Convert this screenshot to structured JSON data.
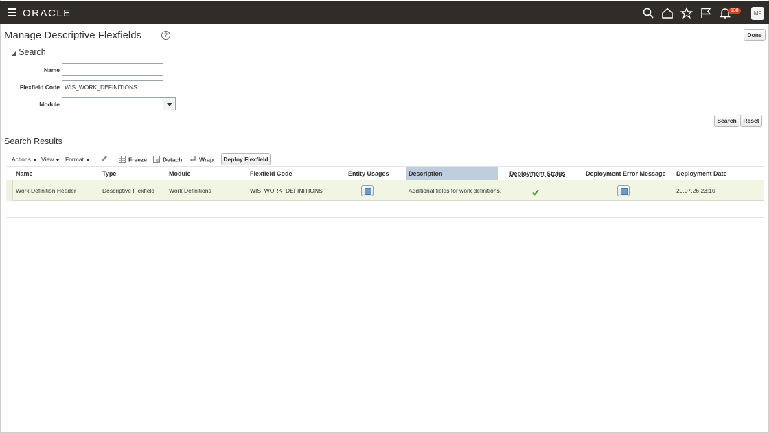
{
  "header": {
    "logo": "ORACLE",
    "notifications_count": "138",
    "user_initials": "MF"
  },
  "page": {
    "title": "Manage Descriptive Flexfields",
    "help": "?",
    "done_label": "Done"
  },
  "search": {
    "section_label": "Search",
    "name_label": "Name",
    "name_value": "",
    "code_label": "Flexfield Code",
    "code_value": "WIS_WORK_DEFINITIONS",
    "module_label": "Module",
    "module_value": "",
    "search_label": "Search",
    "reset_label": "Reset"
  },
  "results": {
    "section_label": "Search Results",
    "toolbar": {
      "actions": "Actions",
      "view": "View",
      "format": "Format",
      "freeze": "Freeze",
      "detach": "Detach",
      "wrap": "Wrap",
      "deploy": "Deploy Flexfield"
    },
    "columns": [
      "Name",
      "Type",
      "Module",
      "Flexfield Code",
      "Entity Usages",
      "Description",
      "Deployment Status",
      "Deployment Error Message",
      "Deployment Date"
    ],
    "rows": [
      {
        "name": "Work Definition Header",
        "type": "Descriptive Flexfield",
        "module": "Work Definitions",
        "code": "WIS_WORK_DEFINITIONS",
        "description": "Additional fields for work definitions.",
        "date": "20.07.26 23:10"
      }
    ]
  },
  "colors": {
    "topbar": "#302c2a",
    "badge": "#d43f1f",
    "selected_row": "#f0f6e3",
    "selected_header": "#bfcede",
    "check": "#4a9a2a"
  }
}
